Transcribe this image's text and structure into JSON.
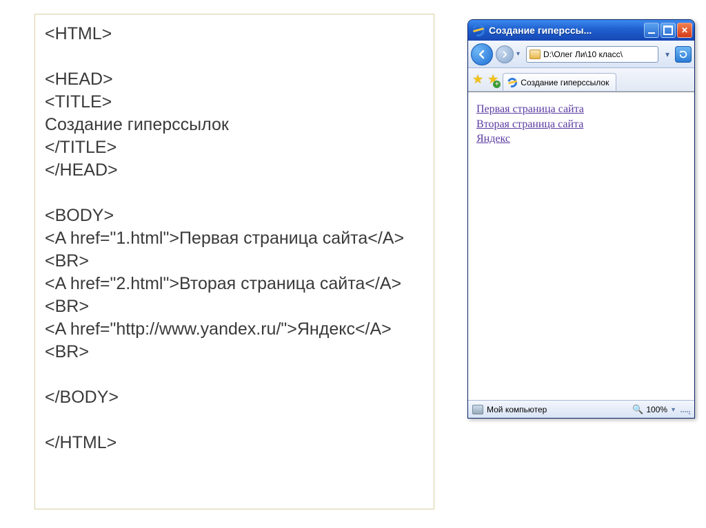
{
  "code": {
    "lines": [
      "<HTML>",
      "",
      "<HEAD>",
      "<TITLE>",
      "Создание гиперссылок",
      "</TITLE>",
      "</HEAD>",
      "",
      "<BODY>",
      "<A href=\"1.html\">Первая страница сайта</A><BR>",
      "<A href=\"2.html\">Вторая страница сайта</A><BR>",
      "<A href=\"http://www.yandex.ru/\">Яндекс</A><BR>",
      "",
      "</BODY>",
      "",
      "</HTML>"
    ]
  },
  "browser": {
    "window_title": "Создание гиперссы...",
    "address": "D:\\Олег Ли\\10 класс\\",
    "tab_label": "Создание гиперссылок",
    "links": [
      "Первая страница сайта",
      "Вторая страница сайта",
      "Яндекс"
    ],
    "status_left": "Мой компьютер",
    "zoom": "100%"
  }
}
